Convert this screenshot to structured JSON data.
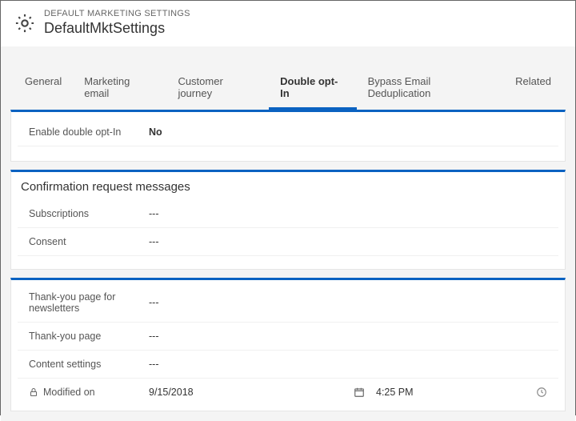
{
  "header": {
    "breadcrumb": "DEFAULT MARKETING SETTINGS",
    "title": "DefaultMktSettings"
  },
  "tabs": {
    "general": "General",
    "marketing_email": "Marketing email",
    "customer_journey": "Customer journey",
    "double_opt_in": "Double opt-In",
    "bypass_dedup": "Bypass Email Deduplication",
    "related": "Related"
  },
  "section1": {
    "enable_label": "Enable double opt-In",
    "enable_value": "No"
  },
  "section2": {
    "title": "Confirmation request messages",
    "subscriptions_label": "Subscriptions",
    "subscriptions_value": "---",
    "consent_label": "Consent",
    "consent_value": "---"
  },
  "section3": {
    "thankyou_news_label": "Thank-you page for newsletters",
    "thankyou_news_value": "---",
    "thankyou_label": "Thank-you page",
    "thankyou_value": "---",
    "content_label": "Content settings",
    "content_value": "---",
    "modified_label": "Modified on",
    "modified_date": "9/15/2018",
    "modified_time": "4:25 PM"
  }
}
